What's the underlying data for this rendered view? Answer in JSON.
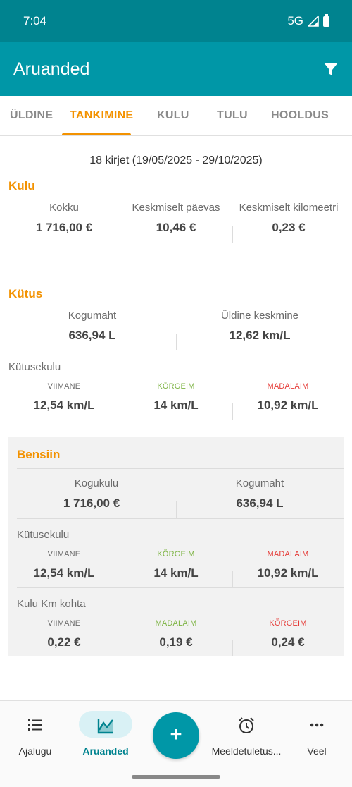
{
  "status_bar": {
    "time": "7:04",
    "network": "5G"
  },
  "app_bar": {
    "title": "Aruanded",
    "filter_icon": "filter-icon"
  },
  "tabs": [
    {
      "label": "ÜLDINE",
      "active": false
    },
    {
      "label": "TANKIMINE",
      "active": true
    },
    {
      "label": "KULU",
      "active": false
    },
    {
      "label": "TULU",
      "active": false
    },
    {
      "label": "HOOLDUS",
      "active": false
    }
  ],
  "summary": "18 kirjet (19/05/2025 - 29/10/2025)",
  "kulu": {
    "title": "Kulu",
    "stats": [
      {
        "label": "Kokku",
        "value": "1 716,00 €"
      },
      {
        "label": "Keskmiselt päevas",
        "value": "10,46 €"
      },
      {
        "label": "Keskmiselt kilomeetri",
        "value": "0,23 €"
      }
    ]
  },
  "kutus": {
    "title": "Kütus",
    "stats": [
      {
        "label": "Kogumaht",
        "value": "636,94 L"
      },
      {
        "label": "Üldine keskmine",
        "value": "12,62 km/L"
      }
    ],
    "consumption_title": "Kütusekulu",
    "consumption": [
      {
        "label": "VIIMANE",
        "value": "12,54 km/L",
        "color": "#6b6b6b"
      },
      {
        "label": "KÕRGEIM",
        "value": "14 km/L",
        "color": "#7cb342"
      },
      {
        "label": "MADALAIM",
        "value": "10,92 km/L",
        "color": "#e53935"
      }
    ]
  },
  "bensiin": {
    "title": "Bensiin",
    "stats": [
      {
        "label": "Kogukulu",
        "value": "1 716,00 €"
      },
      {
        "label": "Kogumaht",
        "value": "636,94 L"
      }
    ],
    "consumption_title": "Kütusekulu",
    "consumption": [
      {
        "label": "VIIMANE",
        "value": "12,54 km/L",
        "color": "#6b6b6b"
      },
      {
        "label": "KÕRGEIM",
        "value": "14 km/L",
        "color": "#7cb342"
      },
      {
        "label": "MADALAIM",
        "value": "10,92 km/L",
        "color": "#e53935"
      }
    ],
    "cost_per_km_title": "Kulu Km kohta",
    "cost_per_km": [
      {
        "label": "VIIMANE",
        "value": "0,22 €",
        "color": "#6b6b6b"
      },
      {
        "label": "MADALAIM",
        "value": "0,19 €",
        "color": "#7cb342"
      },
      {
        "label": "KÕRGEIM",
        "value": "0,24 €",
        "color": "#e53935"
      }
    ]
  },
  "bottom_nav": [
    {
      "label": "Ajalugu",
      "icon": "list-icon",
      "active": false
    },
    {
      "label": "Aruanded",
      "icon": "chart-icon",
      "active": true
    },
    {
      "label": "Meeldetuletus...",
      "icon": "alarm-clock-icon",
      "active": false
    },
    {
      "label": "Veel",
      "icon": "more-icon",
      "active": false
    }
  ],
  "fab": {
    "label": "+",
    "icon": "add-icon"
  },
  "colors": {
    "primary": "#0097a7",
    "status_bar": "#00838f",
    "accent": "#f39200",
    "green": "#7cb342",
    "red": "#e53935"
  }
}
